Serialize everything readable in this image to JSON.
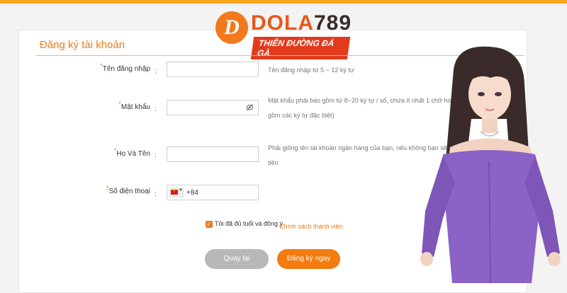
{
  "logo": {
    "mark": "D",
    "brand_a": "DOLA",
    "brand_b": "789",
    "tagline": "THIÊN ĐƯỜNG ĐÁ GÀ"
  },
  "form": {
    "title": "Đăng ký tài khoản",
    "required_mark": "*",
    "colon": ":",
    "fields": [
      {
        "label": "Tên đăng nhập",
        "value": "",
        "hint_lines": [
          "Tên đăng nhập từ 5 ~ 12 ký tự"
        ]
      },
      {
        "label": "Mật khẩu",
        "value": "",
        "icon": "eye-slash-icon",
        "hint_lines": [
          "Mật khẩu phải bao gồm từ 8~20 ký tự / số, chứa ít nhất 1 chữ hoa (Có th",
          "gồm các ký tự đặc biệt)"
        ]
      },
      {
        "label": "Họ Và Tên",
        "value": "",
        "hint_lines": [
          "Phải giống tên tài khoản ngân hàng của bạn, nếu không bạn sẽ không t",
          "tiền"
        ]
      },
      {
        "label": "Số điện thoại",
        "country_flag": "vietnam-flag-icon",
        "value": "+84"
      }
    ],
    "agree_text": "Tôi đã đủ tuổi và đồng ý",
    "policy_link": "Chính sách thành viên",
    "check_glyph": "✓"
  },
  "buttons": {
    "back": "Quay lại",
    "register": "Đăng ký ngay"
  },
  "colors": {
    "accent": "#f37b10",
    "back_button": "#b8b8b8",
    "top_bar": "#f7a51c"
  }
}
